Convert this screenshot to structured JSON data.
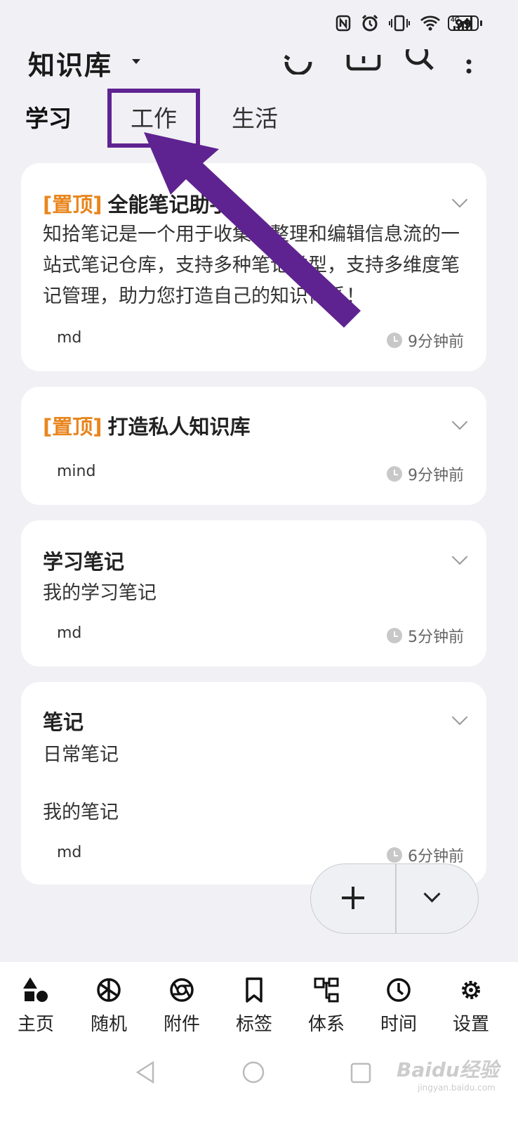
{
  "status_bar": {
    "battery": "99",
    "icons": [
      "nfc-icon",
      "alarm-icon",
      "vibrate-icon",
      "wifi-icon",
      "signal-4g-icon",
      "battery-icon"
    ]
  },
  "header": {
    "title": "知识库",
    "icons": [
      "sync-icon",
      "cloud-icon",
      "search-icon",
      "more-icon"
    ]
  },
  "tabs": [
    {
      "label": "学习",
      "active": true
    },
    {
      "label": "工作",
      "active": false
    },
    {
      "label": "生活",
      "active": false
    }
  ],
  "annotation": {
    "color": "#5e2390"
  },
  "cards": [
    {
      "pin": "[置顶]",
      "title": "全能笔记助手",
      "body": "知拾笔记是一个用于收集、整理和编辑信息流的一站式笔记仓库，支持多种笔记类型，支持多维度笔记管理，助力您打造自己的知识体系！",
      "tag": "md",
      "time": "9分钟前"
    },
    {
      "pin": "[置顶]",
      "title": "打造私人知识库",
      "body": "",
      "tag": "mind",
      "time": "9分钟前"
    },
    {
      "pin": "",
      "title": "学习笔记",
      "body": "我的学习笔记",
      "tag": "md",
      "time": "5分钟前"
    },
    {
      "pin": "",
      "title": "笔记",
      "body": "日常笔记",
      "body2": "我的笔记",
      "tag": "md",
      "time": "6分钟前"
    }
  ],
  "fab": {
    "add_icon": "plus-icon",
    "expand_icon": "chevron-down-icon"
  },
  "bottom_nav": [
    {
      "label": "主页",
      "icon": "home-shapes-icon"
    },
    {
      "label": "随机",
      "icon": "random-icon"
    },
    {
      "label": "附件",
      "icon": "aperture-icon"
    },
    {
      "label": "标签",
      "icon": "bookmark-icon"
    },
    {
      "label": "体系",
      "icon": "hierarchy-icon"
    },
    {
      "label": "时间",
      "icon": "clock-icon"
    },
    {
      "label": "设置",
      "icon": "gear-icon"
    }
  ],
  "watermark": {
    "text": "Baidu经验",
    "sub": "jingyan.baidu.com"
  }
}
